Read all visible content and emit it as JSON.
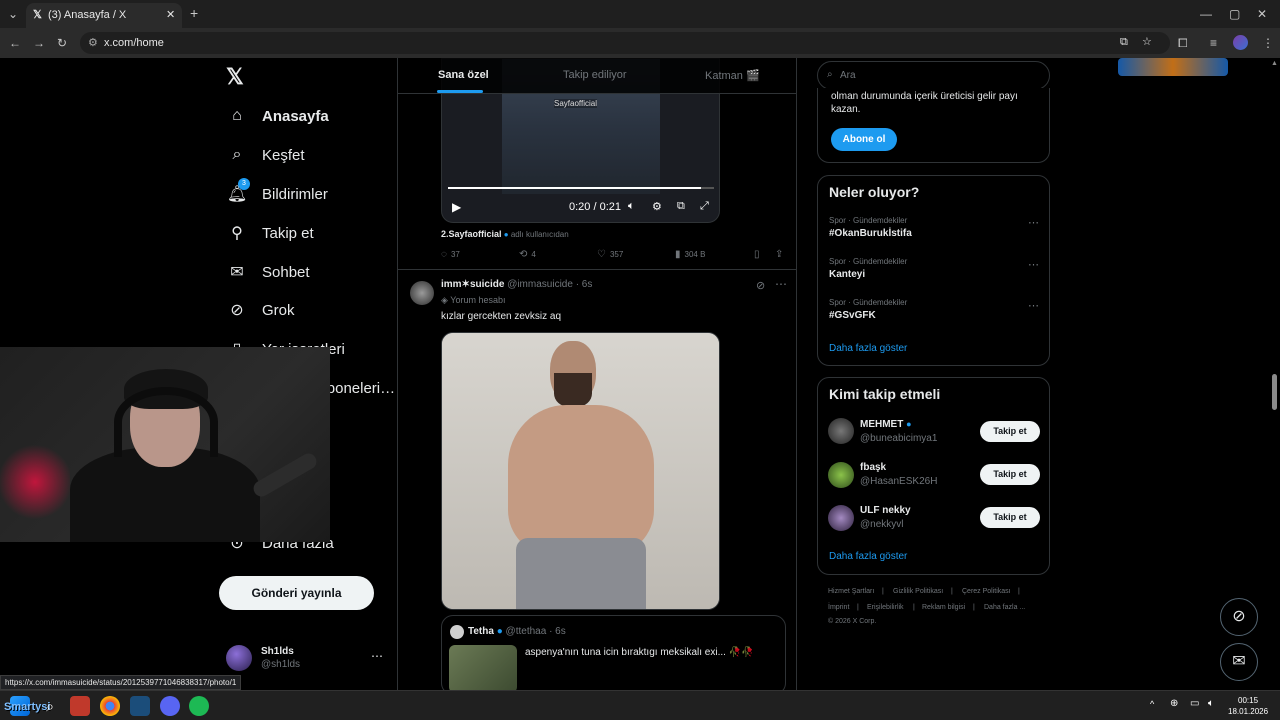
{
  "browser": {
    "tab_title": "(3) Anasayfa / X",
    "url": "x.com/home",
    "status_url": "https://x.com/immasuicide/status/2012539771046838317/photo/1"
  },
  "nav": {
    "items": [
      {
        "label": "Anasayfa",
        "icon": "home-icon"
      },
      {
        "label": "Keşfet",
        "icon": "search-icon"
      },
      {
        "label": "Bildirimler",
        "icon": "bell-icon",
        "badge": "3"
      },
      {
        "label": "Takip et",
        "icon": "add-user-icon"
      },
      {
        "label": "Sohbet",
        "icon": "mail-icon"
      },
      {
        "label": "Grok",
        "icon": "grok-icon"
      },
      {
        "label": "Yer işaretleri",
        "icon": "bookmark-icon"
      },
      {
        "label": "Premium Abonelerin Aboneleri İçerik Üreticisi St...",
        "icon": "premium-icon"
      },
      {
        "label": "Daha fazla",
        "icon": "more-circle-icon"
      }
    ],
    "post_button": "Gönderi yayınla",
    "account": {
      "name": "Sh1lds",
      "handle": "@sh1lds"
    }
  },
  "feed": {
    "tabs": [
      "Sana özel",
      "Takip ediliyor",
      "Katman 🎬"
    ],
    "active_tab": 0,
    "video": {
      "time": "0:20 / 0:21",
      "watermark": "Sayfaofficial",
      "progress": 0.95
    },
    "tweet1": {
      "source_user": "2.Sayfaofficial",
      "source_suffix": "adlı kullanıcıdan",
      "replies": "37",
      "reposts": "4",
      "likes": "357",
      "views": "304 B"
    },
    "tweet2": {
      "name": "imm✶suicide",
      "handle": "@immasuicide",
      "time": "· 6s",
      "tag": "Yorum hesabı",
      "text": "kızlar gercekten zevksiz aq"
    },
    "quote": {
      "name": "Tetha",
      "handle": "@ttethaa",
      "time": "· 6s",
      "text": "aspenya'nın tuna icin bıraktıgı meksikalı exi... 🥀🥀"
    }
  },
  "sidebar": {
    "search_placeholder": "Ara",
    "premium_text_line1": "olman durumunda içerik üreticisi gelir payı",
    "premium_text_line2": "kazan.",
    "subscribe_button": "Abone ol",
    "trends_title": "Neler oluyor?",
    "trends": [
      {
        "meta": "Spor · Gündemdekiler",
        "name": "#OkanBurukİstifa"
      },
      {
        "meta": "Spor · Gündemdekiler",
        "name": "Kanteyi"
      },
      {
        "meta": "Spor · Gündemdekiler",
        "name": "#GSvGFK"
      }
    ],
    "trends_more": "Daha fazla göster",
    "who_title": "Kimi takip etmeli",
    "who": [
      {
        "name": "MEHMET",
        "handle": "@buneabicimya1",
        "verified": true
      },
      {
        "name": "fbaşk",
        "handle": "@HasanESK26H",
        "verified": false
      },
      {
        "name": "ULF nekky",
        "handle": "@nekkyvl",
        "verified": false
      }
    ],
    "follow_label": "Takip et",
    "who_more": "Daha fazla göster",
    "footer": [
      "Hizmet Şartları",
      "|",
      "Gizlilik Politikası",
      "|",
      "Çerez Politikası",
      "|",
      "İmprint",
      "|",
      "Erişilebilirlik",
      "|",
      "Reklam bilgisi",
      "|",
      "Daha fazla ...",
      "© 2026 X Corp."
    ]
  },
  "taskbar": {
    "time": "00:15",
    "date": "18.01.2026",
    "webcam_overlay_text": "Smartysi"
  },
  "colors": {
    "accent": "#1d9bf0",
    "bg": "#000000",
    "border": "#2f3336",
    "muted": "#71767b"
  }
}
